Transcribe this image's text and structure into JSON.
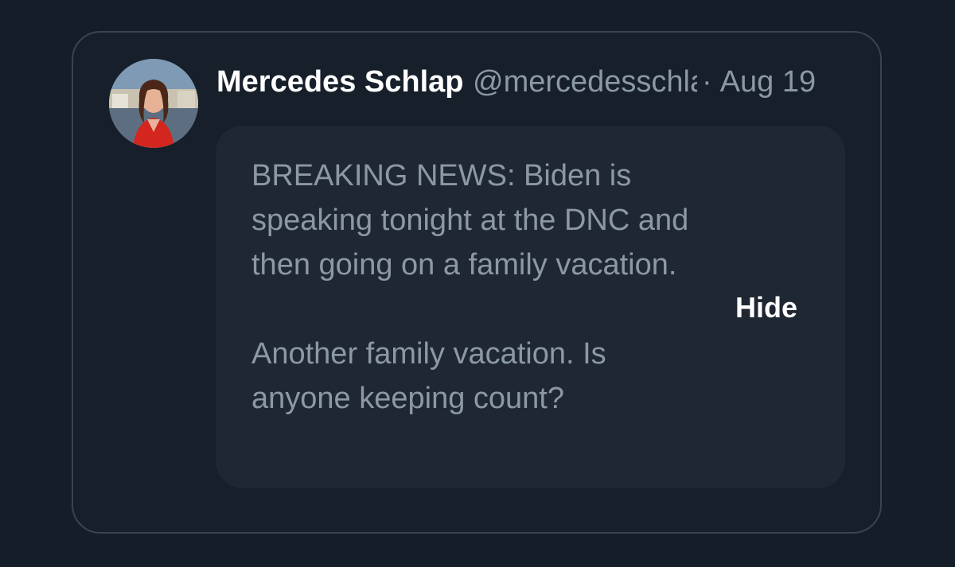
{
  "tweet": {
    "display_name": "Mercedes Schlapp",
    "handle": "@mercedesschlapp",
    "separator": "·",
    "date": "Aug 19",
    "hidden_reply": {
      "paragraphs": [
        "BREAKING NEWS: Biden is speaking tonight at the DNC and then going on a family vacation.",
        "Another family vacation.  Is anyone keeping count?"
      ],
      "hide_label": "Hide"
    }
  },
  "colors": {
    "background": "#151d28",
    "card_border": "#38444f",
    "hidden_box": "#1f2732",
    "muted_text": "#8b98a5",
    "primary_text": "#ffffff"
  },
  "icons": {
    "avatar": "profile-photo-avatar"
  }
}
